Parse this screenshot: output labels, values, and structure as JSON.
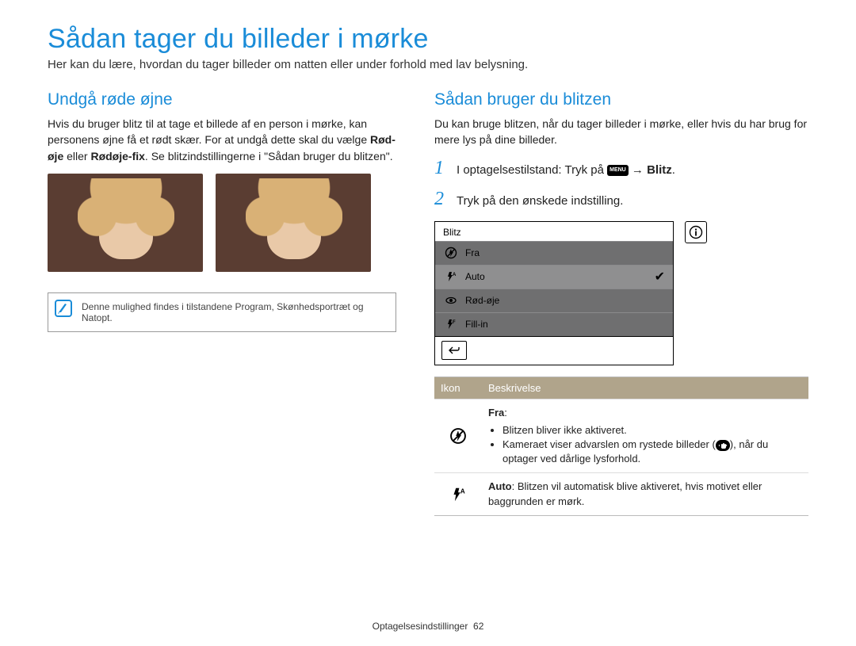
{
  "title": "Sådan tager du billeder i mørke",
  "intro": "Her kan du lære, hvordan du tager billeder om natten eller under forhold med lav belysning.",
  "left": {
    "heading": "Undgå røde øjne",
    "body_pre": "Hvis du bruger blitz til at tage et billede af en person i mørke, kan personens øjne få et rødt skær. For at undgå dette skal du vælge ",
    "bold1": "Rød-øje",
    "mid": " eller ",
    "bold2": "Rødøje-fix",
    "body_post": ". Se blitzindstillingerne i \"Sådan bruger du blitzen\".",
    "note": "Denne mulighed findes i tilstandene Program, Skønhedsportræt og Natopt."
  },
  "right": {
    "heading": "Sådan bruger du blitzen",
    "intro": "Du kan bruge blitzen, når du tager billeder i mørke, eller hvis du har brug for mere lys på dine billeder.",
    "step1_pre": "I optagelsestilstand: Tryk på ",
    "menu_label": "MENU",
    "arrow": " → ",
    "step1_bold": "Blitz",
    "step2": "Tryk på den ønskede indstilling.",
    "screen": {
      "title": "Blitz",
      "items": [
        {
          "label": "Fra",
          "icon": "flash-off"
        },
        {
          "label": "Auto",
          "icon": "flash-auto",
          "selected": true
        },
        {
          "label": "Rød-øje",
          "icon": "eye"
        },
        {
          "label": "Fill-in",
          "icon": "flash-fill"
        }
      ]
    },
    "table": {
      "col1": "Ikon",
      "col2": "Beskrivelse",
      "rows": [
        {
          "icon": "flash-off",
          "title": "Fra",
          "bullets": [
            "Blitzen bliver ikke aktiveret.",
            "Kameraet viser advarslen om rystede billeder ( § ), når du optager ved dårlige lysforhold."
          ]
        },
        {
          "icon": "flash-auto",
          "title": "Auto",
          "text": ": Blitzen vil automatisk blive aktiveret, hvis motivet eller baggrunden er mørk."
        }
      ]
    }
  },
  "footer": {
    "section": "Optagelsesindstillinger",
    "page": "62"
  }
}
